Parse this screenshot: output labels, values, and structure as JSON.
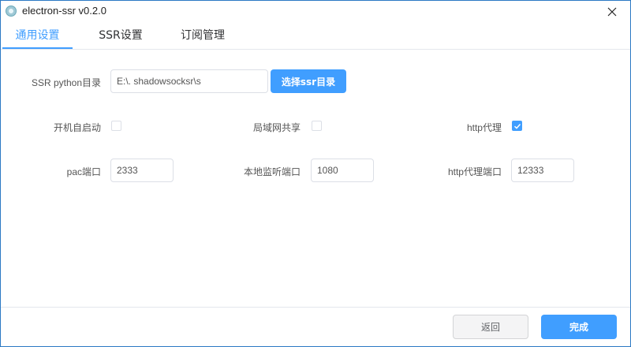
{
  "window": {
    "title": "electron-ssr v0.2.0",
    "accent": "#409eff"
  },
  "tabs": [
    {
      "label": "通用设置",
      "active": true
    },
    {
      "label": "SSR设置",
      "active": false
    },
    {
      "label": "订阅管理",
      "active": false
    }
  ],
  "general": {
    "ssr_dir_label": "SSR python目录",
    "ssr_dir_value": "E:\\.                    shadowsocksr\\s",
    "choose_dir_button": "选择ssr目录",
    "autostart_label": "开机自启动",
    "autostart_checked": false,
    "lan_share_label": "局域网共享",
    "lan_share_checked": false,
    "http_proxy_label": "http代理",
    "http_proxy_checked": true,
    "pac_port_label": "pac端口",
    "pac_port_value": "2333",
    "local_port_label": "本地监听端口",
    "local_port_value": "1080",
    "http_port_label": "http代理端口",
    "http_port_value": "12333"
  },
  "footer": {
    "back_button": "返回",
    "done_button": "完成"
  }
}
